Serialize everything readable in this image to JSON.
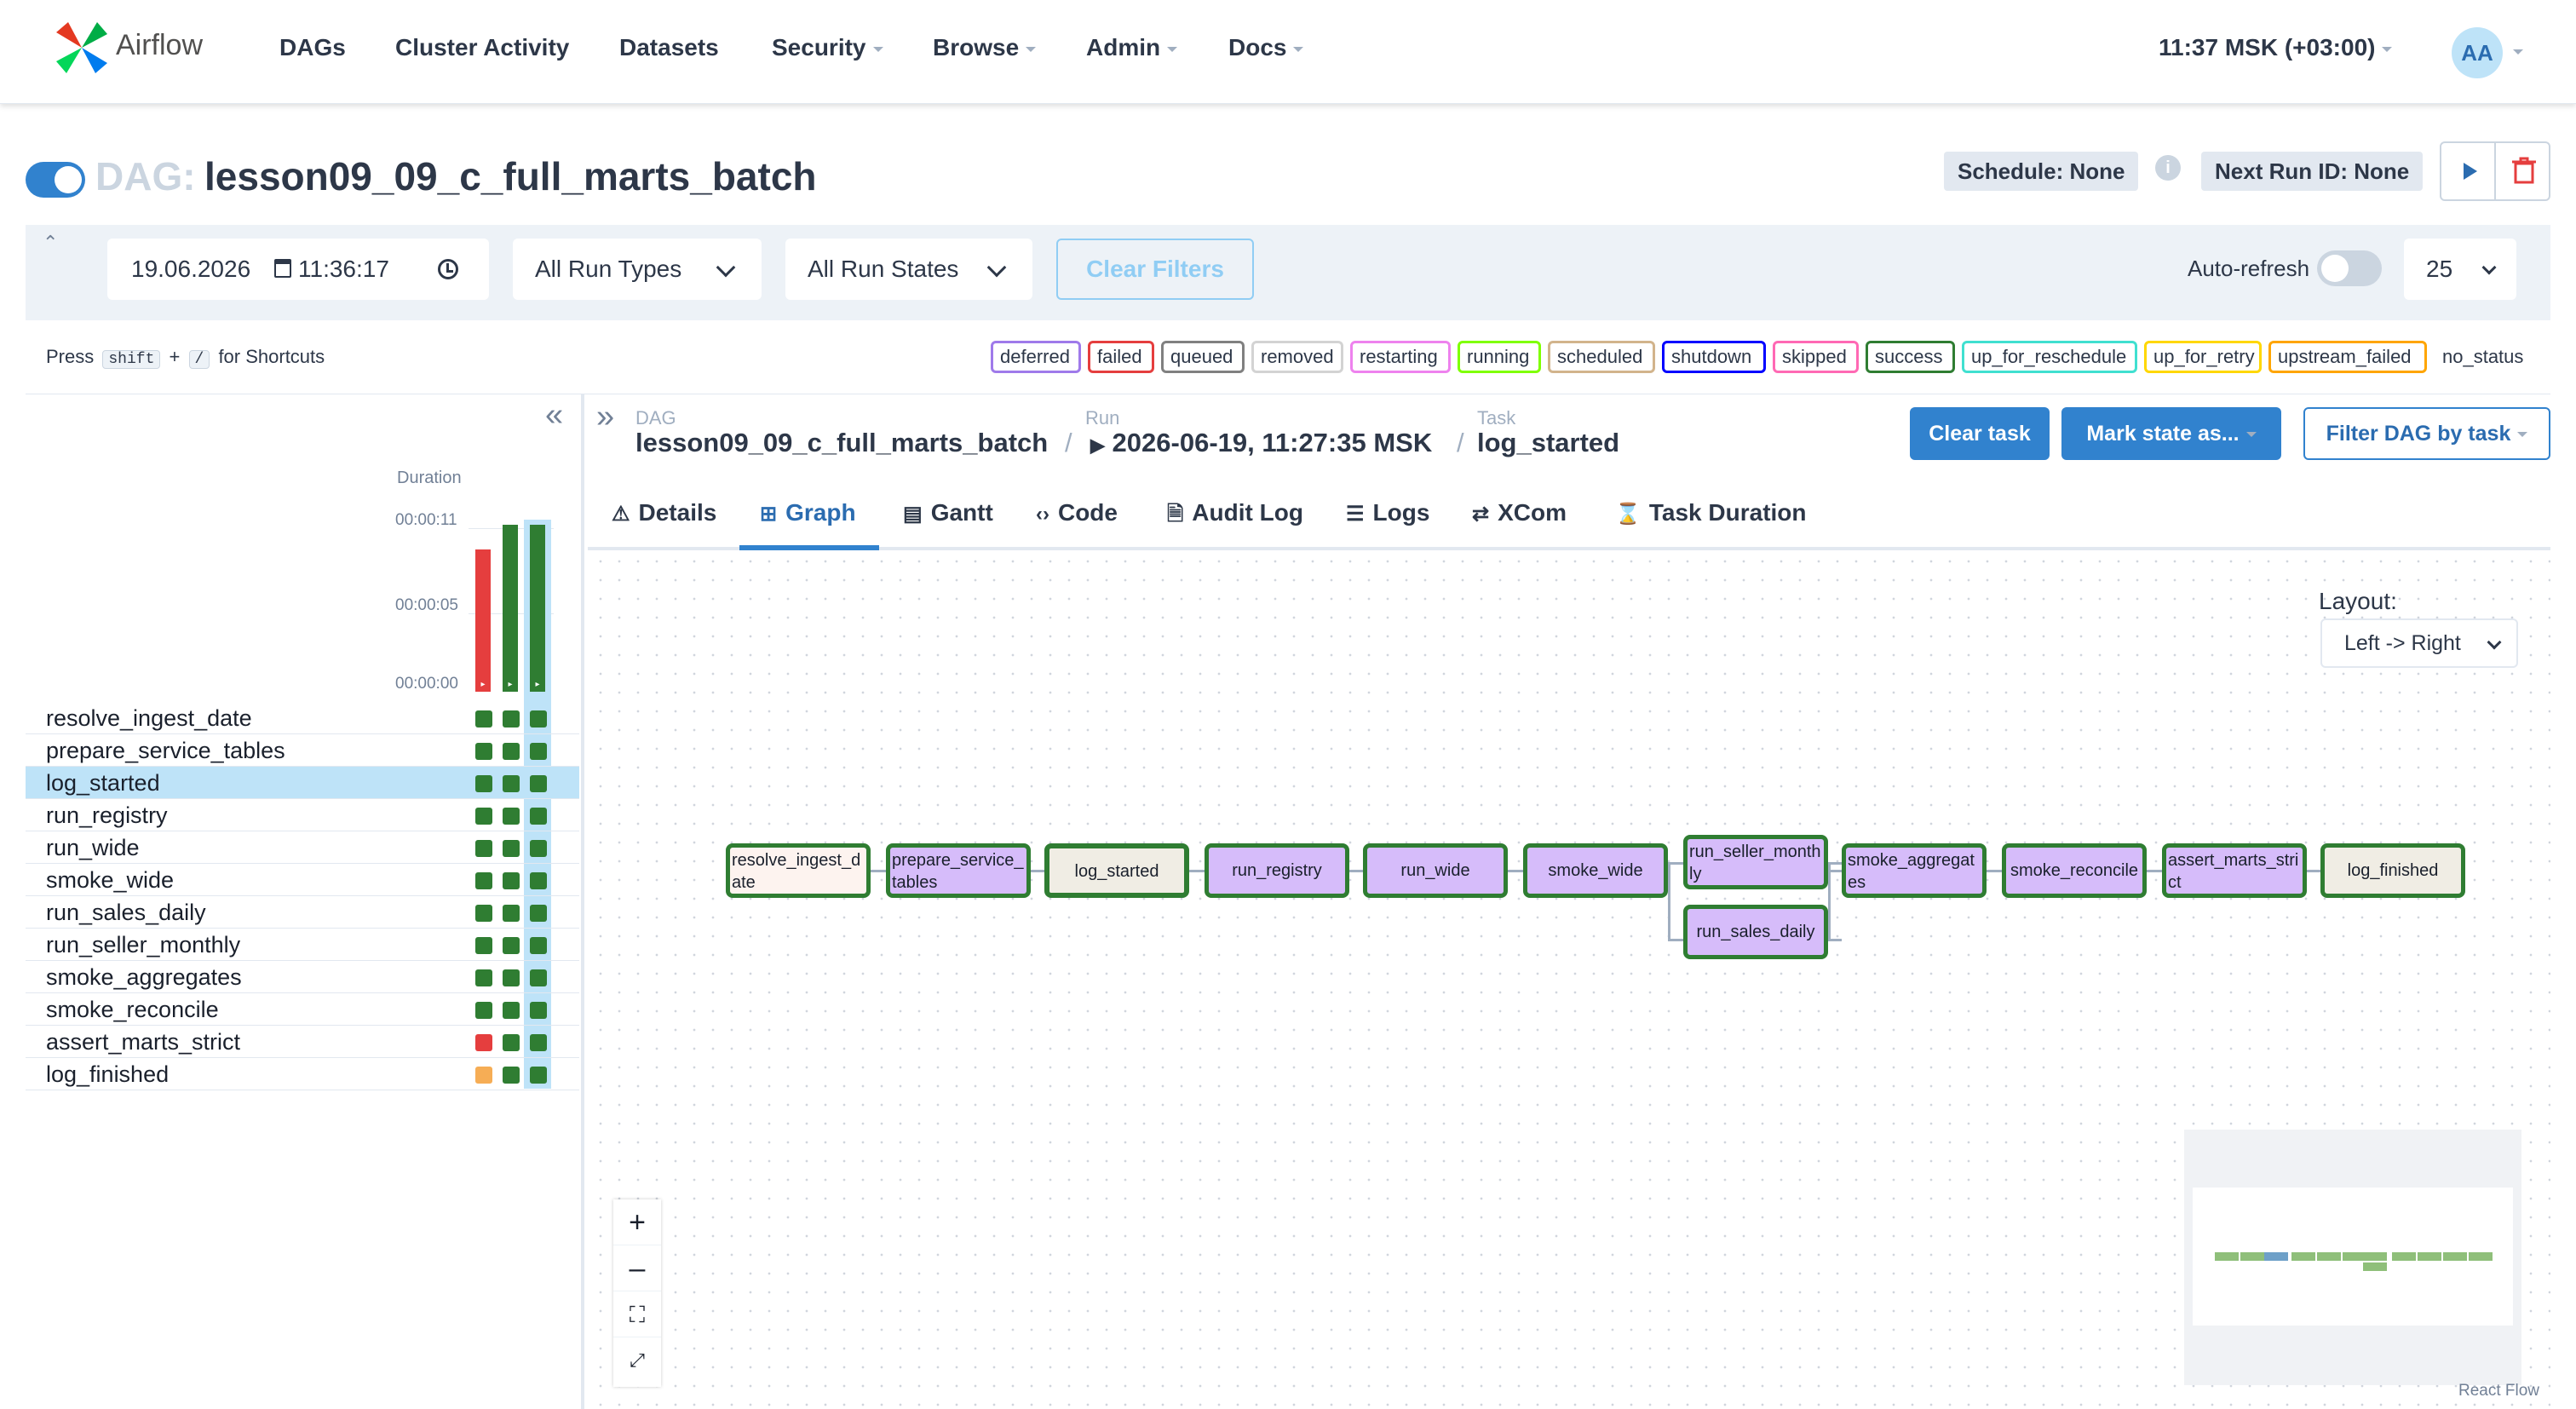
{
  "navbar": {
    "brand": "Airflow",
    "items": [
      "DAGs",
      "Cluster Activity",
      "Datasets",
      "Security",
      "Browse",
      "Admin",
      "Docs"
    ],
    "time": "11:37 MSK (+03:00)",
    "avatar": "AA"
  },
  "dag": {
    "prefix": "DAG:",
    "name": "lesson09_09_c_full_marts_batch",
    "schedule": "Schedule: None",
    "next_run": "Next Run ID: None"
  },
  "filters": {
    "date": "19.06.2026",
    "time": "11:36:17",
    "run_types": "All Run Types",
    "run_states": "All Run States",
    "clear": "Clear Filters",
    "auto_refresh": "Auto-refresh",
    "count": "25"
  },
  "shortcuts": {
    "press": "Press",
    "key1": "shift",
    "plus": "+",
    "key2": "/",
    "suffix": "for Shortcuts"
  },
  "legend": [
    {
      "label": "deferred",
      "color": "#9f7aea"
    },
    {
      "label": "failed",
      "color": "#e53e3e"
    },
    {
      "label": "queued",
      "color": "#808080"
    },
    {
      "label": "removed",
      "color": "#d3d3d3"
    },
    {
      "label": "restarting",
      "color": "#ee82ee"
    },
    {
      "label": "running",
      "color": "#7fff00"
    },
    {
      "label": "scheduled",
      "color": "#d2b48c"
    },
    {
      "label": "shutdown",
      "color": "#0000ff"
    },
    {
      "label": "skipped",
      "color": "#ff69b4"
    },
    {
      "label": "success",
      "color": "#2f7d32"
    },
    {
      "label": "up_for_reschedule",
      "color": "#40e0d0"
    },
    {
      "label": "up_for_retry",
      "color": "#ffd700"
    },
    {
      "label": "upstream_failed",
      "color": "#ffa500"
    },
    {
      "label": "no_status",
      "color": "transparent"
    }
  ],
  "grid": {
    "duration_label": "Duration",
    "ticks": [
      "00:00:11",
      "00:00:05",
      "00:00:00"
    ],
    "runs": [
      {
        "duration_fraction": 0.85,
        "color": "#e53e3e"
      },
      {
        "duration_fraction": 1.0,
        "color": "#2f7d32"
      },
      {
        "duration_fraction": 1.0,
        "color": "#2f7d32"
      }
    ],
    "tasks": [
      {
        "name": "resolve_ingest_date",
        "states": [
          "#2f7d32",
          "#2f7d32",
          "#2f7d32"
        ]
      },
      {
        "name": "prepare_service_tables",
        "states": [
          "#2f7d32",
          "#2f7d32",
          "#2f7d32"
        ]
      },
      {
        "name": "log_started",
        "states": [
          "#2f7d32",
          "#2f7d32",
          "#2f7d32"
        ]
      },
      {
        "name": "run_registry",
        "states": [
          "#2f7d32",
          "#2f7d32",
          "#2f7d32"
        ]
      },
      {
        "name": "run_wide",
        "states": [
          "#2f7d32",
          "#2f7d32",
          "#2f7d32"
        ]
      },
      {
        "name": "smoke_wide",
        "states": [
          "#2f7d32",
          "#2f7d32",
          "#2f7d32"
        ]
      },
      {
        "name": "run_sales_daily",
        "states": [
          "#2f7d32",
          "#2f7d32",
          "#2f7d32"
        ]
      },
      {
        "name": "run_seller_monthly",
        "states": [
          "#2f7d32",
          "#2f7d32",
          "#2f7d32"
        ]
      },
      {
        "name": "smoke_aggregates",
        "states": [
          "#2f7d32",
          "#2f7d32",
          "#2f7d32"
        ]
      },
      {
        "name": "smoke_reconcile",
        "states": [
          "#2f7d32",
          "#2f7d32",
          "#2f7d32"
        ]
      },
      {
        "name": "assert_marts_strict",
        "states": [
          "#e53e3e",
          "#2f7d32",
          "#2f7d32"
        ]
      },
      {
        "name": "log_finished",
        "states": [
          "#f6ad55",
          "#2f7d32",
          "#2f7d32"
        ]
      }
    ]
  },
  "breadcrumb": {
    "dag_label": "DAG",
    "dag_value": "lesson09_09_c_full_marts_batch",
    "run_label": "Run",
    "run_value": "2026-06-19, 11:27:35 MSK",
    "task_label": "Task",
    "task_value": "log_started",
    "sep": "/"
  },
  "actions": {
    "clear_task": "Clear task",
    "mark_state": "Mark state as...",
    "filter_dag": "Filter DAG by task"
  },
  "tabs": [
    {
      "label": "Details",
      "icon": "warning-triangle-icon",
      "glyph": "⚠"
    },
    {
      "label": "Graph",
      "icon": "graph-icon",
      "glyph": "⊞"
    },
    {
      "label": "Gantt",
      "icon": "gantt-icon",
      "glyph": "▤"
    },
    {
      "label": "Code",
      "icon": "code-icon",
      "glyph": "‹›"
    },
    {
      "label": "Audit Log",
      "icon": "audit-log-icon",
      "glyph": "🗎"
    },
    {
      "label": "Logs",
      "icon": "logs-icon",
      "glyph": "☰"
    },
    {
      "label": "XCom",
      "icon": "xcom-icon",
      "glyph": "⇄"
    },
    {
      "label": "Task Duration",
      "icon": "hourglass-icon",
      "glyph": "⌛"
    }
  ],
  "graph": {
    "layout_label": "Layout:",
    "layout_value": "Left -> Right",
    "nodes": [
      {
        "label": "resolve_ingest_date",
        "color": "#fdf3ef"
      },
      {
        "label": "prepare_service_tables",
        "color": "#d6bcfa"
      },
      {
        "label": "log_started",
        "color": "#f0ede4"
      },
      {
        "label": "run_registry",
        "color": "#d6bcfa"
      },
      {
        "label": "run_wide",
        "color": "#d6bcfa"
      },
      {
        "label": "smoke_wide",
        "color": "#d6bcfa"
      },
      {
        "label": "run_seller_monthly",
        "color": "#d6bcfa"
      },
      {
        "label": "run_sales_daily",
        "color": "#d6bcfa"
      },
      {
        "label": "smoke_aggregates",
        "color": "#d6bcfa"
      },
      {
        "label": "smoke_reconcile",
        "color": "#d6bcfa"
      },
      {
        "label": "assert_marts_strict",
        "color": "#d6bcfa"
      },
      {
        "label": "log_finished",
        "color": "#f0ede4"
      }
    ],
    "attribution": "React Flow"
  }
}
